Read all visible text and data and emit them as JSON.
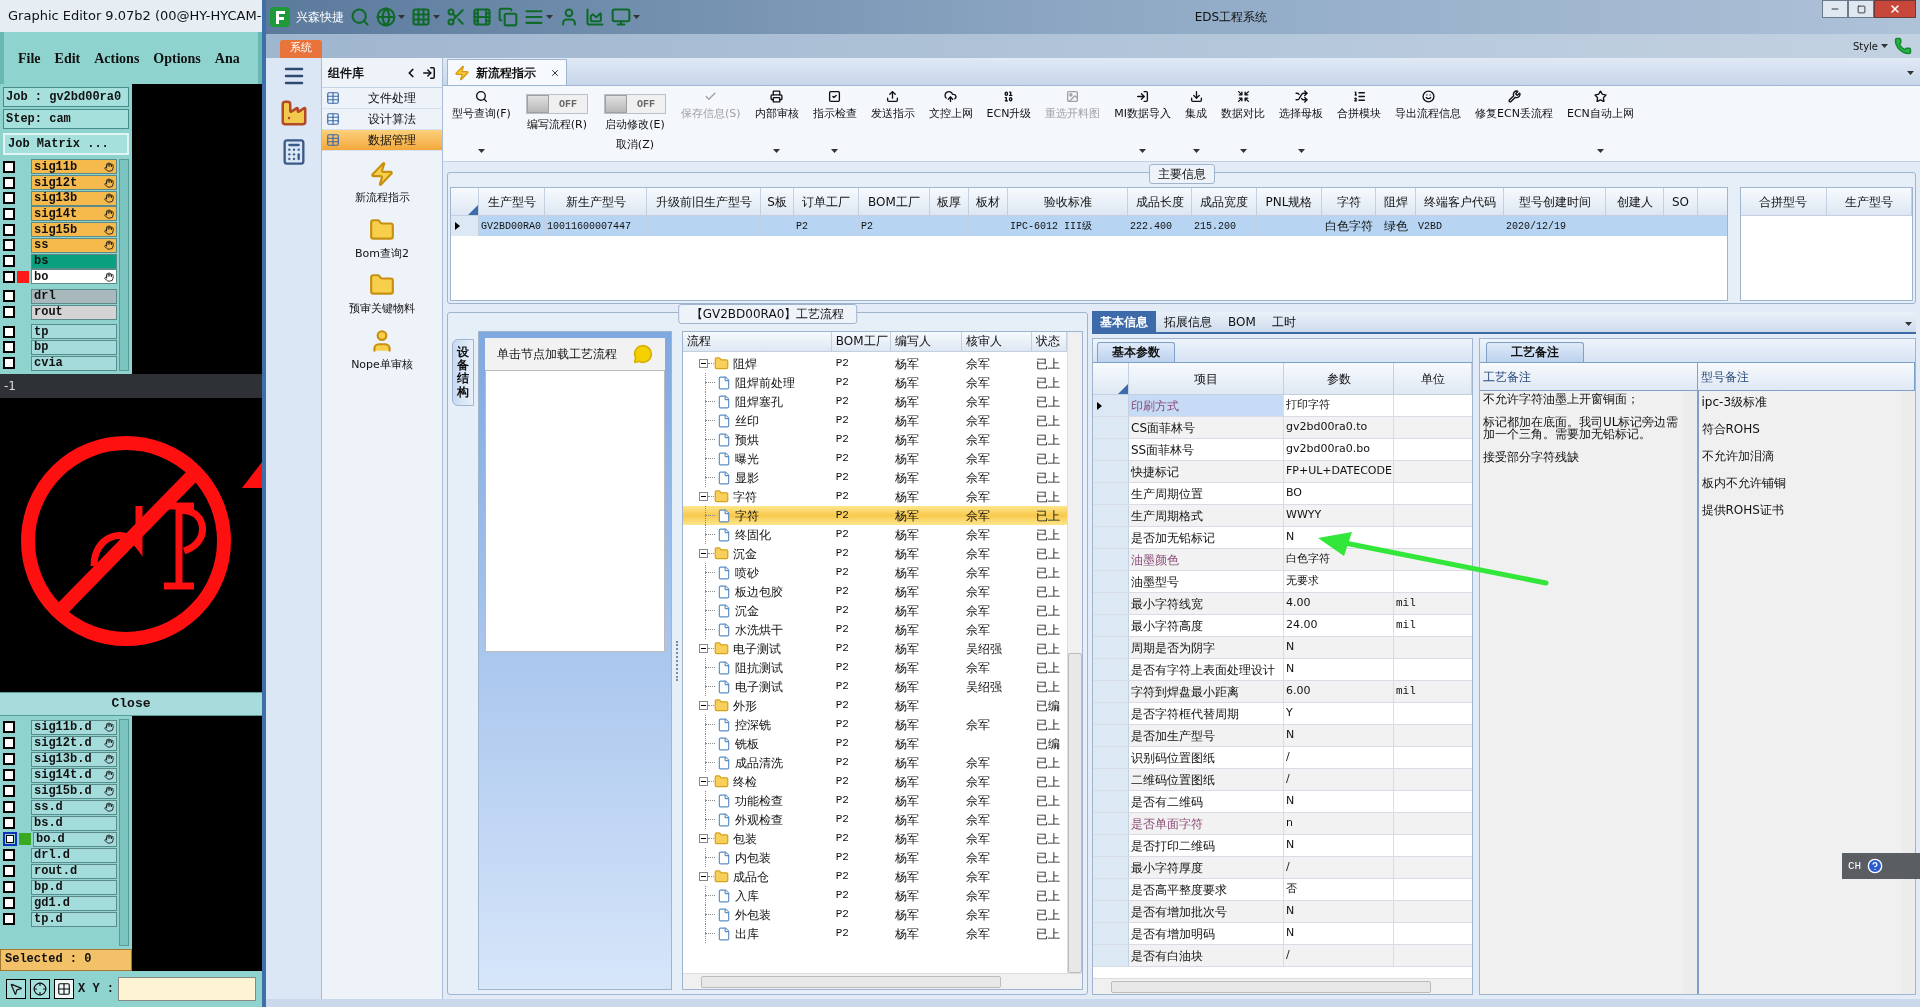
{
  "graphic_editor": {
    "title": "Graphic Editor 9.07b2 (00@HY-HYCAM-",
    "menu": [
      "File",
      "Edit",
      "Actions",
      "Options",
      "Ana"
    ],
    "job": "Job : gv2bd00ra0",
    "step": "Step: cam",
    "job_matrix_button": "Job Matrix ...",
    "layers": [
      {
        "name": "sig11b",
        "color": "#f5b94c",
        "marked": true,
        "checked": false
      },
      {
        "name": "sig12t",
        "color": "#f5b94c",
        "marked": true,
        "checked": false
      },
      {
        "name": "sig13b",
        "color": "#f5b94c",
        "marked": true,
        "checked": false
      },
      {
        "name": "sig14t",
        "color": "#f5b94c",
        "marked": true,
        "checked": false
      },
      {
        "name": "sig15b",
        "color": "#f5b94c",
        "marked": true,
        "checked": false
      },
      {
        "name": "ss",
        "color": "#f5b94c",
        "marked": true,
        "checked": false
      },
      {
        "name": "bs",
        "color": "#08a07e",
        "marked": false,
        "checked": false
      },
      {
        "name": "bo",
        "color": "#ffffff",
        "marked": true,
        "checked": false,
        "marker": {
          "color": "#ff1a1a"
        }
      },
      {
        "name": "drl",
        "color": "#a8b8bc",
        "marked": false,
        "checked": false
      },
      {
        "name": "rout",
        "color": "#d4d4d4",
        "marked": false,
        "checked": false
      },
      {
        "name": "tp",
        "color": "#a4dcdc",
        "marked": false,
        "checked": false
      },
      {
        "name": "bp",
        "color": "#a4dcdc",
        "marked": false,
        "checked": false
      },
      {
        "name": "cvia",
        "color": "#a4dcdc",
        "marked": false,
        "checked": false
      }
    ],
    "view_label": "-1",
    "close_button": "Close",
    "output_layers": [
      {
        "name": "sig11b.d",
        "marked": true,
        "selected": false,
        "checked": false
      },
      {
        "name": "sig12t.d",
        "marked": true,
        "selected": false,
        "checked": false
      },
      {
        "name": "sig13b.d",
        "marked": true,
        "selected": false,
        "checked": false
      },
      {
        "name": "sig14t.d",
        "marked": true,
        "selected": false,
        "checked": false
      },
      {
        "name": "sig15b.d",
        "marked": true,
        "selected": false,
        "checked": false
      },
      {
        "name": "ss.d",
        "marked": true,
        "selected": false,
        "checked": false
      },
      {
        "name": "bs.d",
        "marked": false,
        "selected": false,
        "checked": false
      },
      {
        "name": "bo.d",
        "marked": true,
        "selected": true,
        "checked": false,
        "marker": {
          "color": "#3aa820"
        }
      },
      {
        "name": "drl.d",
        "marked": false,
        "selected": false,
        "checked": false
      },
      {
        "name": "rout.d",
        "marked": false,
        "selected": false,
        "checked": false
      },
      {
        "name": "bp.d",
        "marked": false,
        "selected": false,
        "checked": false
      },
      {
        "name": "gd1.d",
        "marked": false,
        "selected": false,
        "checked": false
      },
      {
        "name": "tp.d",
        "marked": false,
        "selected": false,
        "checked": false
      }
    ],
    "selected_count": "Selected : 0",
    "xy_label": "X Y :"
  },
  "eds": {
    "app_name": "兴森快捷",
    "title": "EDS工程系统",
    "system_tab": "系统",
    "style_menu": "Style",
    "sidebar": {
      "title": "组件库",
      "items": [
        {
          "label": "文件处理",
          "selected": false
        },
        {
          "label": "设计算法",
          "selected": false
        },
        {
          "label": "数据管理",
          "selected": true
        }
      ],
      "shortcuts": [
        "新流程指示",
        "Bom查询2",
        "预审关键物料",
        "Nope单审核"
      ]
    },
    "tab": {
      "label": "新流程指示"
    },
    "ribbon": [
      {
        "kind": "button",
        "label": "型号查询(F)",
        "has_menu": true,
        "disabled": false
      },
      {
        "kind": "toggle",
        "label": "编写流程(R)",
        "state_text": "OFF",
        "on": false
      },
      {
        "kind": "toggle",
        "label": "启动修改(E)",
        "sublabel": "取消(Z)",
        "state_text": "OFF",
        "on": false
      },
      {
        "kind": "button",
        "label": "保存信息(S)",
        "has_menu": false,
        "disabled": true
      },
      {
        "kind": "button",
        "label": "内部审核",
        "has_menu": true,
        "disabled": false
      },
      {
        "kind": "button",
        "label": "指示检查",
        "has_menu": true,
        "disabled": false
      },
      {
        "kind": "button",
        "label": "发送指示",
        "has_menu": false,
        "disabled": false
      },
      {
        "kind": "button",
        "label": "文控上网",
        "has_menu": false,
        "disabled": false
      },
      {
        "kind": "button",
        "label": "ECN升级",
        "has_menu": false,
        "disabled": false
      },
      {
        "kind": "button",
        "label": "重选开料图",
        "has_menu": false,
        "disabled": true
      },
      {
        "kind": "button",
        "label": "MI数据导入",
        "has_menu": true,
        "disabled": false
      },
      {
        "kind": "button",
        "label": "集成",
        "has_menu": true,
        "disabled": false
      },
      {
        "kind": "button",
        "label": "数据对比",
        "has_menu": true,
        "disabled": false
      },
      {
        "kind": "button",
        "label": "选择母板",
        "has_menu": true,
        "disabled": false
      },
      {
        "kind": "button",
        "label": "合拼模块",
        "has_menu": false,
        "disabled": false
      },
      {
        "kind": "button",
        "label": "导出流程信息",
        "has_menu": false,
        "disabled": false
      },
      {
        "kind": "button",
        "label": "修复ECN丢流程",
        "has_menu": false,
        "disabled": false
      },
      {
        "kind": "button",
        "label": "ECN自动上网",
        "has_menu": true,
        "disabled": false
      }
    ],
    "main_info": {
      "title": "主要信息",
      "row_selected": true,
      "columns": [
        {
          "heading": "生产型号",
          "cell": "GV2BD00RA0"
        },
        {
          "heading": "新生产型号",
          "cell": "10011600007447"
        },
        {
          "heading": "升级前旧生产型号"
        },
        {
          "heading": "S板"
        },
        {
          "heading": "订单工厂",
          "cell": "P2"
        },
        {
          "heading": "BOM工厂",
          "cell": "P2"
        },
        {
          "heading": "板厚"
        },
        {
          "heading": "板材"
        },
        {
          "heading": "验收标准",
          "cell": "IPC-6012 III级"
        },
        {
          "heading": "成品长度",
          "cell": "222.400"
        },
        {
          "heading": "成品宽度",
          "cell": "215.200"
        },
        {
          "heading": "PNL规格"
        },
        {
          "heading": "字符",
          "cell": "白色字符"
        },
        {
          "heading": "阻焊",
          "cell": "绿色"
        },
        {
          "heading": "终端客户代码",
          "cell": "V2BD"
        },
        {
          "heading": "型号创建时间",
          "cell": "2020/12/19"
        },
        {
          "heading": "创建人"
        },
        {
          "heading": "SO"
        }
      ],
      "side_columns": [
        "合拼型号",
        "生产型号"
      ]
    },
    "process": {
      "title": "【GV2BD00RA0】工艺流程",
      "side_tab": "设备结构",
      "hint": "单击节点加载工艺流程",
      "columns": [
        "流程",
        "BOM工厂",
        "编写人",
        "核审人",
        "状态"
      ],
      "tree": [
        {
          "name": "阻焊",
          "factory": "P2",
          "writer": "杨军",
          "reviewer": "佘军",
          "status": "已上",
          "expanded": true,
          "children": [
            {
              "name": "阻焊前处理",
              "factory": "P2",
              "writer": "杨军",
              "reviewer": "佘军",
              "status": "已上",
              "selected": false
            },
            {
              "name": "阻焊塞孔",
              "factory": "P2",
              "writer": "杨军",
              "reviewer": "佘军",
              "status": "已上",
              "selected": false
            },
            {
              "name": "丝印",
              "factory": "P2",
              "writer": "杨军",
              "reviewer": "佘军",
              "status": "已上",
              "selected": false
            },
            {
              "name": "预烘",
              "factory": "P2",
              "writer": "杨军",
              "reviewer": "佘军",
              "status": "已上",
              "selected": false
            },
            {
              "name": "曝光",
              "factory": "P2",
              "writer": "杨军",
              "reviewer": "佘军",
              "status": "已上",
              "selected": false
            },
            {
              "name": "显影",
              "factory": "P2",
              "writer": "杨军",
              "reviewer": "佘军",
              "status": "已上",
              "selected": false
            }
          ]
        },
        {
          "name": "字符",
          "factory": "P2",
          "writer": "杨军",
          "reviewer": "佘军",
          "status": "已上",
          "expanded": true,
          "children": [
            {
              "name": "字符",
              "factory": "P2",
              "writer": "杨军",
              "reviewer": "佘军",
              "status": "已上",
              "selected": true
            },
            {
              "name": "终固化",
              "factory": "P2",
              "writer": "杨军",
              "reviewer": "佘军",
              "status": "已上",
              "selected": false
            }
          ]
        },
        {
          "name": "沉金",
          "factory": "P2",
          "writer": "杨军",
          "reviewer": "佘军",
          "status": "已上",
          "expanded": true,
          "children": [
            {
              "name": "喷砂",
              "factory": "P2",
              "writer": "杨军",
              "reviewer": "佘军",
              "status": "已上",
              "selected": false
            },
            {
              "name": "板边包胶",
              "factory": "P2",
              "writer": "杨军",
              "reviewer": "佘军",
              "status": "已上",
              "selected": false
            },
            {
              "name": "沉金",
              "factory": "P2",
              "writer": "杨军",
              "reviewer": "佘军",
              "status": "已上",
              "selected": false
            },
            {
              "name": "水洗烘干",
              "factory": "P2",
              "writer": "杨军",
              "reviewer": "佘军",
              "status": "已上",
              "selected": false
            }
          ]
        },
        {
          "name": "电子测试",
          "factory": "P2",
          "writer": "杨军",
          "reviewer": "吴绍强",
          "status": "已上",
          "expanded": true,
          "children": [
            {
              "name": "阻抗测试",
              "factory": "P2",
              "writer": "杨军",
              "reviewer": "佘军",
              "status": "已上",
              "selected": false
            },
            {
              "name": "电子测试",
              "factory": "P2",
              "writer": "杨军",
              "reviewer": "吴绍强",
              "status": "已上",
              "selected": false
            }
          ]
        },
        {
          "name": "外形",
          "factory": "P2",
          "writer": "杨军",
          "status": "已编",
          "expanded": true,
          "children": [
            {
              "name": "控深铣",
              "factory": "P2",
              "writer": "杨军",
              "reviewer": "佘军",
              "status": "已上",
              "selected": false
            },
            {
              "name": "铣板",
              "factory": "P2",
              "writer": "杨军",
              "status": "已编",
              "selected": false
            },
            {
              "name": "成品清洗",
              "factory": "P2",
              "writer": "杨军",
              "reviewer": "佘军",
              "status": "已上",
              "selected": false
            }
          ]
        },
        {
          "name": "终检",
          "factory": "P2",
          "writer": "杨军",
          "reviewer": "佘军",
          "status": "已上",
          "expanded": true,
          "children": [
            {
              "name": "功能检查",
              "factory": "P2",
              "writer": "杨军",
              "reviewer": "佘军",
              "status": "已上",
              "selected": false
            },
            {
              "name": "外观检查",
              "factory": "P2",
              "writer": "杨军",
              "reviewer": "佘军",
              "status": "已上",
              "selected": false
            }
          ]
        },
        {
          "name": "包装",
          "factory": "P2",
          "writer": "杨军",
          "reviewer": "佘军",
          "status": "已上",
          "expanded": true,
          "children": [
            {
              "name": "内包装",
              "factory": "P2",
              "writer": "杨军",
              "reviewer": "佘军",
              "status": "已上",
              "selected": false
            }
          ]
        },
        {
          "name": "成品仓",
          "factory": "P2",
          "writer": "杨军",
          "reviewer": "佘军",
          "status": "已上",
          "expanded": true,
          "children": [
            {
              "name": "入库",
              "factory": "P2",
              "writer": "杨军",
              "reviewer": "佘军",
              "status": "已上",
              "selected": false
            },
            {
              "name": "外包装",
              "factory": "P2",
              "writer": "杨军",
              "reviewer": "佘军",
              "status": "已上",
              "selected": false
            },
            {
              "name": "出库",
              "factory": "P2",
              "writer": "杨军",
              "reviewer": "佘军",
              "status": "已上",
              "selected": false
            }
          ]
        }
      ]
    },
    "detail_tabs": [
      {
        "label": "基本信息",
        "selected": true
      },
      {
        "label": "拓展信息",
        "selected": false
      },
      {
        "label": "BOM",
        "selected": false
      },
      {
        "label": "工时",
        "selected": false
      }
    ],
    "params": {
      "tab": "基本参数",
      "columns": [
        "项目",
        "参数",
        "单位"
      ],
      "rows": [
        {
          "item": "印刷方式",
          "value": "打印字符",
          "highlighted": true,
          "current": true
        },
        {
          "item": "CS面菲林号",
          "value": "gv2bd00ra0.to",
          "highlighted": false,
          "current": false
        },
        {
          "item": "SS面菲林号",
          "value": "gv2bd00ra0.bo",
          "highlighted": false,
          "current": false
        },
        {
          "item": "快捷标记",
          "value": "FP+UL+DATECODE",
          "highlighted": false,
          "current": false
        },
        {
          "item": "生产周期位置",
          "value": "BO",
          "highlighted": false,
          "current": false
        },
        {
          "item": "生产周期格式",
          "value": "WWYY",
          "highlighted": false,
          "current": false
        },
        {
          "item": "是否加无铅标记",
          "value": "N",
          "highlighted": false,
          "current": false
        },
        {
          "item": "油墨颜色",
          "value": "白色字符",
          "highlighted": true,
          "current": false
        },
        {
          "item": "油墨型号",
          "value": "无要求",
          "highlighted": false,
          "current": false
        },
        {
          "item": "最小字符线宽",
          "value": "4.00",
          "unit": "mil",
          "highlighted": false,
          "current": false
        },
        {
          "item": "最小字符高度",
          "value": "24.00",
          "unit": "mil",
          "highlighted": false,
          "current": false
        },
        {
          "item": "周期是否为阴字",
          "value": "N",
          "highlighted": false,
          "current": false
        },
        {
          "item": "是否有字符上表面处理设计",
          "value": "N",
          "highlighted": false,
          "current": false
        },
        {
          "item": "字符到焊盘最小距离",
          "value": "6.00",
          "unit": "mil",
          "highlighted": false,
          "current": false
        },
        {
          "item": "是否字符框代替周期",
          "value": "Y",
          "highlighted": false,
          "current": false
        },
        {
          "item": "是否加生产型号",
          "value": "N",
          "highlighted": false,
          "current": false
        },
        {
          "item": "识别码位置图纸",
          "value": "/",
          "highlighted": false,
          "current": false
        },
        {
          "item": "二维码位置图纸",
          "value": "/",
          "highlighted": false,
          "current": false
        },
        {
          "item": "是否有二维码",
          "value": "N",
          "highlighted": false,
          "current": false
        },
        {
          "item": "是否单面字符",
          "value": "n",
          "highlighted": true,
          "current": false
        },
        {
          "item": "是否打印二维码",
          "value": "N",
          "highlighted": false,
          "current": false
        },
        {
          "item": "最小字符厚度",
          "value": "/",
          "highlighted": false,
          "current": false
        },
        {
          "item": "是否高平整度要求",
          "value": "否",
          "highlighted": false,
          "current": false
        },
        {
          "item": "是否有增加批次号",
          "value": "N",
          "highlighted": false,
          "current": false
        },
        {
          "item": "是否有增加明码",
          "value": "N",
          "highlighted": false,
          "current": false
        },
        {
          "item": "是否有白油块",
          "value": "/",
          "highlighted": false,
          "current": false
        }
      ]
    },
    "notes": {
      "tab": "工艺备注",
      "columns": [
        "工艺备注",
        "型号备注"
      ],
      "process_notes": [
        "不允许字符油墨上开窗铜面；",
        "标记都加在底面。我司UL标记旁边需加一个三角。需要加无铅标记。",
        "接受部分字符残缺"
      ],
      "model_notes": [
        "ipc-3级标准",
        "符合ROHS",
        "不允许加泪滴",
        "板内不允许铺铜",
        "提供ROHS证书"
      ]
    },
    "language_bar": "CH"
  }
}
